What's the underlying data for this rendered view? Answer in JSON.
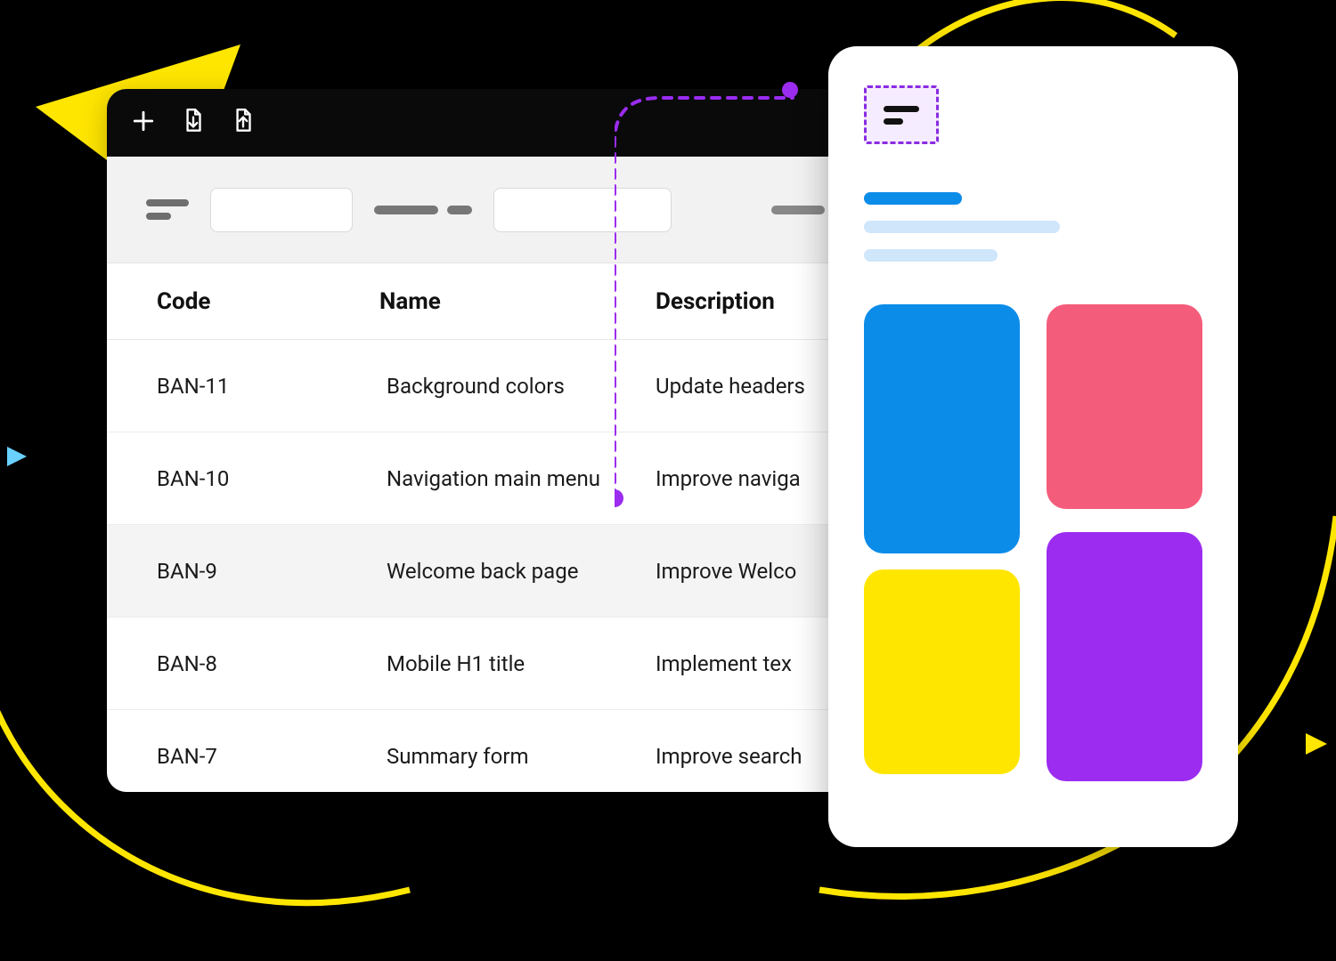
{
  "colors": {
    "accent_purple": "#9b2cf0",
    "accent_blue": "#0c8ce9",
    "accent_pink": "#f45c7b",
    "accent_yellow": "#ffe600"
  },
  "icons": {
    "add": "plus-icon",
    "import": "download-file-icon",
    "export": "upload-file-icon",
    "menu": "menu-icon"
  },
  "table": {
    "headers": {
      "code": "Code",
      "name": "Name",
      "description": "Description"
    },
    "rows": [
      {
        "code": "BAN-11",
        "name": "Background colors",
        "description": "Update headers"
      },
      {
        "code": "BAN-10",
        "name": "Navigation main menu",
        "description": "Improve naviga"
      },
      {
        "code": "BAN-9",
        "name": "Welcome back page",
        "description": "Improve Welco"
      },
      {
        "code": "BAN-8",
        "name": "Mobile H1 title",
        "description": "Implement  tex"
      },
      {
        "code": "BAN-7",
        "name": "Summary form",
        "description": "Improve search"
      }
    ],
    "selected_index": 2
  },
  "detail_card": {
    "tiles": [
      "blue",
      "pink",
      "yellow",
      "purple"
    ]
  }
}
